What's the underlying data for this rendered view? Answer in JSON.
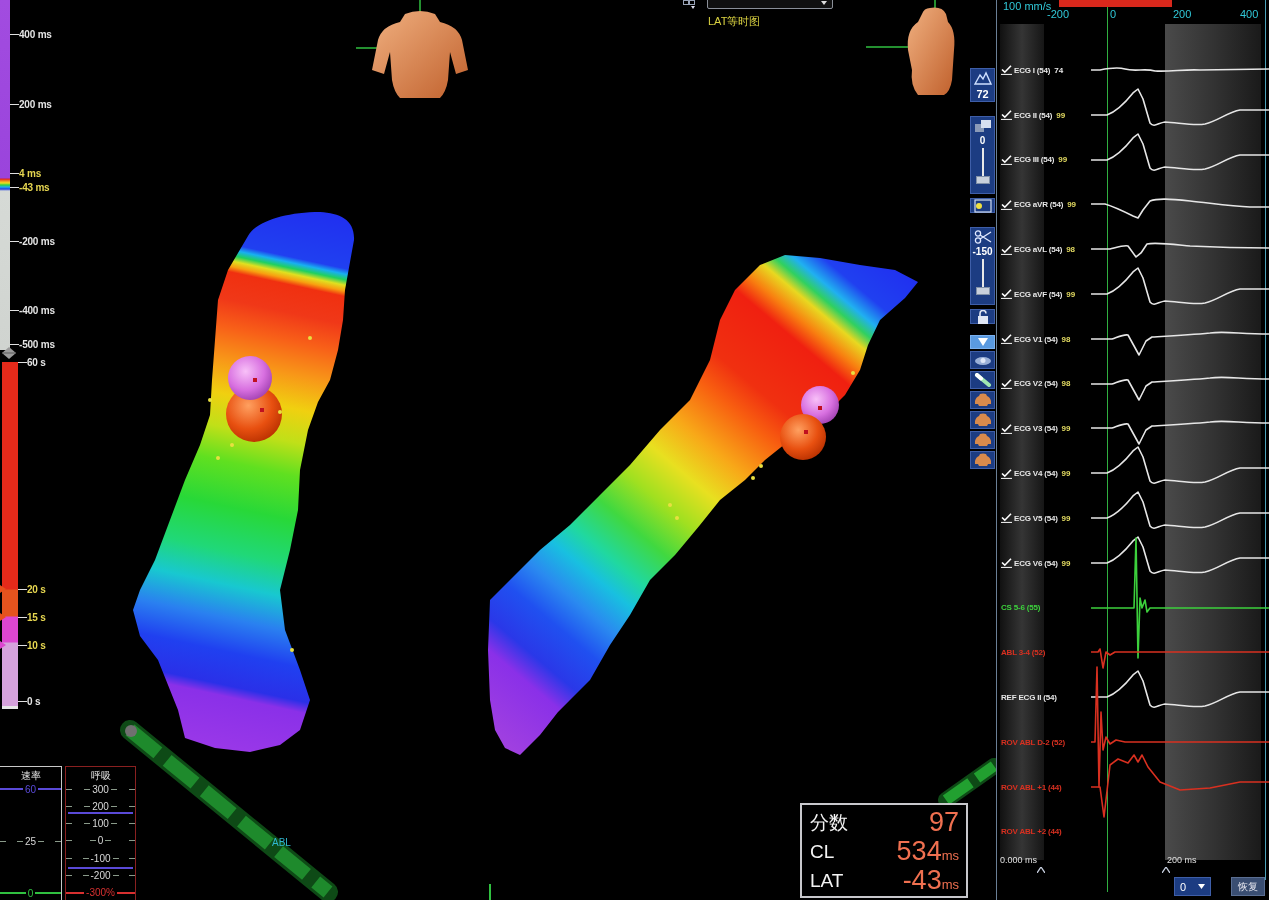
{
  "lat_scale": {
    "labels": [
      {
        "text": "400 ms",
        "highlight": false
      },
      {
        "text": "200 ms",
        "highlight": false
      },
      {
        "text": "4 ms",
        "highlight": true
      },
      {
        "text": "-43 ms",
        "highlight": true
      },
      {
        "text": "-200 ms",
        "highlight": false
      },
      {
        "text": "-400 ms",
        "highlight": false
      },
      {
        "text": "-500 ms",
        "highlight": false
      }
    ]
  },
  "time_scale": {
    "labels": [
      {
        "text": "60 s",
        "highlight": false
      },
      {
        "text": "20 s",
        "highlight": true
      },
      {
        "text": "15 s",
        "highlight": true
      },
      {
        "text": "10 s",
        "highlight": true
      },
      {
        "text": "0 s",
        "highlight": false
      }
    ]
  },
  "gauges": [
    {
      "title": "速率",
      "labels": [
        {
          "text": "60",
          "color": "#5a4ad8"
        },
        {
          "text": "25"
        },
        {
          "text": "0",
          "color": "#30c040"
        }
      ]
    },
    {
      "title": "呼吸",
      "labels": [
        {
          "text": "300"
        },
        {
          "text": "200"
        },
        {
          "text": "100"
        },
        {
          "text": "0"
        },
        {
          "text": "-100"
        },
        {
          "text": "-200"
        },
        {
          "text": "-300%",
          "color": "#d83030"
        }
      ]
    }
  ],
  "map_view": {
    "map_type": "LAT等时图",
    "catheter_label": "ABL"
  },
  "summary": {
    "rows": [
      {
        "label": "分数",
        "value": "97"
      },
      {
        "label": "CL",
        "value": "534",
        "unit": "ms"
      },
      {
        "label": "LAT",
        "value": "-43",
        "unit": "ms"
      }
    ]
  },
  "toolbar": {
    "items": [
      {
        "kind": "counter",
        "value": "72"
      },
      {
        "kind": "slider",
        "value": "0",
        "level": 0
      },
      {
        "kind": "button"
      },
      {
        "kind": "slider",
        "value": "-150",
        "level": 0
      },
      {
        "kind": "button"
      },
      {
        "kind": "dropdown"
      },
      {
        "kind": "button"
      },
      {
        "kind": "button"
      },
      {
        "kind": "button"
      },
      {
        "kind": "button"
      },
      {
        "kind": "button"
      },
      {
        "kind": "button"
      }
    ]
  },
  "ecg_panel": {
    "sweep_speed": "100 mm/s",
    "axis_ticks": [
      "-200",
      "0",
      "200",
      "400"
    ],
    "traces": [
      {
        "label": "ECG I (54)",
        "score": "74",
        "score_high": false,
        "checked": true,
        "color": "#e6e6e6"
      },
      {
        "label": "ECG II (54)",
        "score": "99",
        "score_high": true,
        "checked": true,
        "color": "#e6e6e6"
      },
      {
        "label": "ECG III (54)",
        "score": "99",
        "score_high": true,
        "checked": true,
        "color": "#e6e6e6"
      },
      {
        "label": "ECG aVR (54)",
        "score": "99",
        "score_high": true,
        "checked": true,
        "color": "#e6e6e6"
      },
      {
        "label": "ECG aVL (54)",
        "score": "98",
        "score_high": true,
        "checked": true,
        "color": "#e6e6e6"
      },
      {
        "label": "ECG aVF (54)",
        "score": "99",
        "score_high": true,
        "checked": true,
        "color": "#e6e6e6"
      },
      {
        "label": "ECG V1 (54)",
        "score": "98",
        "score_high": true,
        "checked": true,
        "color": "#e6e6e6"
      },
      {
        "label": "ECG V2 (54)",
        "score": "98",
        "score_high": true,
        "checked": true,
        "color": "#e6e6e6"
      },
      {
        "label": "ECG V3 (54)",
        "score": "99",
        "score_high": true,
        "checked": true,
        "color": "#e6e6e6"
      },
      {
        "label": "ECG V4 (54)",
        "score": "99",
        "score_high": true,
        "checked": true,
        "color": "#e6e6e6"
      },
      {
        "label": "ECG V5 (54)",
        "score": "99",
        "score_high": true,
        "checked": true,
        "color": "#e6e6e6"
      },
      {
        "label": "ECG V6 (54)",
        "score": "99",
        "score_high": true,
        "checked": true,
        "color": "#e6e6e6"
      },
      {
        "label": "CS 5-6 (55)",
        "checked": false,
        "color": "#3cd03c"
      },
      {
        "label": "ABL 3-4 (52)",
        "checked": false,
        "color": "#d83020"
      },
      {
        "label": "REF ECG II (54)",
        "checked": false,
        "color": "#e6e6e6"
      },
      {
        "label": "ROV ABL D-2 (52)",
        "checked": false,
        "color": "#d83020"
      },
      {
        "label": "ROV ABL +1 (44)",
        "checked": false,
        "color": "#d83020"
      },
      {
        "label": "ROV ABL +2 (44)",
        "checked": false,
        "color": "#d83020"
      }
    ],
    "window_labels": [
      "0.000 ms",
      "200 ms"
    ],
    "gain_select": "0",
    "restore_button": "恢复"
  }
}
